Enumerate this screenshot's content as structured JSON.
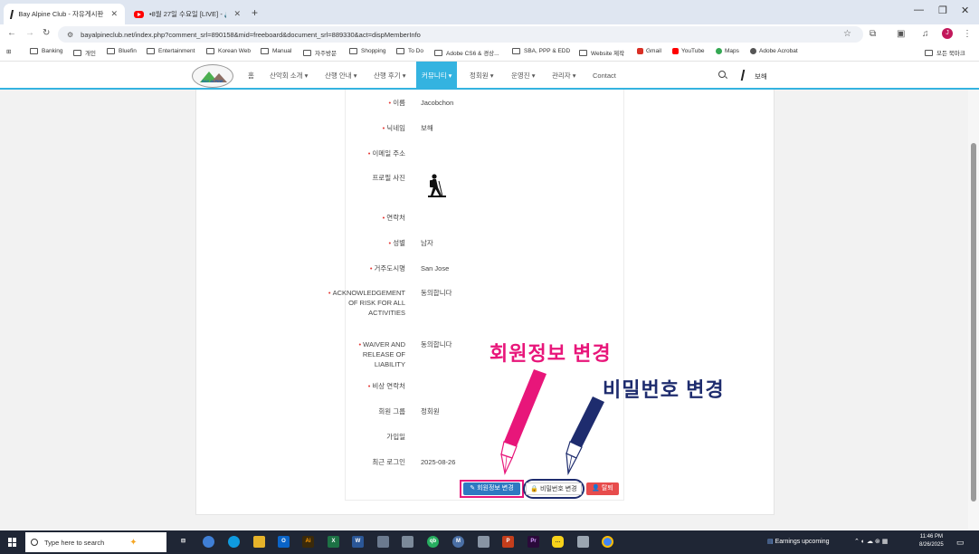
{
  "browser": {
    "tabs": [
      {
        "title": "Bay Alpine Club - 자유게시판",
        "active": true
      },
      {
        "title": "•8월 27일 수요일 [LIVE] - 🔊",
        "active": false
      }
    ],
    "url": "bayalpineclub.net/index.php?comment_srl=890158&mid=freeboard&document_srl=889330&act=dispMemberInfo",
    "profile_initial": "J",
    "bookmarks": [
      "Banking",
      "개인",
      "Bluefin",
      "Entertainment",
      "Korean Web",
      "Manual",
      "자주방문",
      "Shopping",
      "To Do",
      "Adobe CS6 & 경상...",
      "SBA, PPP & EDD",
      "Website 제작",
      "Gmail",
      "YouTube",
      "Maps",
      "Adobe Acrobat"
    ],
    "all_bookmarks": "모든 북마크"
  },
  "site": {
    "logo_text": "BAY ALPINE",
    "menu": [
      {
        "label": "홈"
      },
      {
        "label": "산악회 소개 ▾"
      },
      {
        "label": "산행 안내 ▾"
      },
      {
        "label": "산행 후기 ▾"
      },
      {
        "label": "커뮤니티 ▾",
        "active": true
      },
      {
        "label": "정회원 ▾"
      },
      {
        "label": "운영진 ▾"
      },
      {
        "label": "관리자 ▾"
      },
      {
        "label": "Contact"
      }
    ],
    "user_name": "보해"
  },
  "profile": {
    "fields": [
      {
        "label": "이름",
        "required": true,
        "value": "Jacobchon"
      },
      {
        "label": "닉네임",
        "required": true,
        "value": "보해"
      },
      {
        "label": "이메일 주소",
        "required": true,
        "value": ""
      },
      {
        "label": "프로필 사진",
        "required": false,
        "value": ""
      },
      {
        "label": "연락처",
        "required": true,
        "value": ""
      },
      {
        "label": "성별",
        "required": true,
        "value": "남자"
      },
      {
        "label": "거주도시명",
        "required": true,
        "value": "San Jose"
      },
      {
        "label": "ACKNOWLEDGEMENT OF RISK FOR ALL ACTIVITIES",
        "required": true,
        "value": "동의합니다"
      },
      {
        "label": "WAIVER AND RELEASE OF LIABILITY",
        "required": true,
        "value": "동의합니다"
      },
      {
        "label": "비상 연락처",
        "required": true,
        "value": ""
      },
      {
        "label": "회원 그룹",
        "required": false,
        "value": "정회원"
      },
      {
        "label": "가입일",
        "required": false,
        "value": ""
      },
      {
        "label": "최근 로그인",
        "required": false,
        "value": "2025-08-26"
      }
    ],
    "buttons": {
      "edit": "✎ 회원정보 변경",
      "password": "🔒 비밀번호 변경",
      "quit": "👤 탈퇴"
    }
  },
  "annotations": {
    "edit_info": "회원정보 변경",
    "change_password": "비밀번호 변경"
  },
  "taskbar": {
    "search_placeholder": "Type here to search",
    "weather": "Earnings upcoming",
    "time": "11:46 PM",
    "date": "8/26/2025"
  },
  "colors": {
    "accent": "#34b3e0",
    "edit_button": "#2f79c2",
    "quit_button": "#e74c4c",
    "annotation_pink": "#e8167a",
    "annotation_navy": "#1e2c6e"
  }
}
